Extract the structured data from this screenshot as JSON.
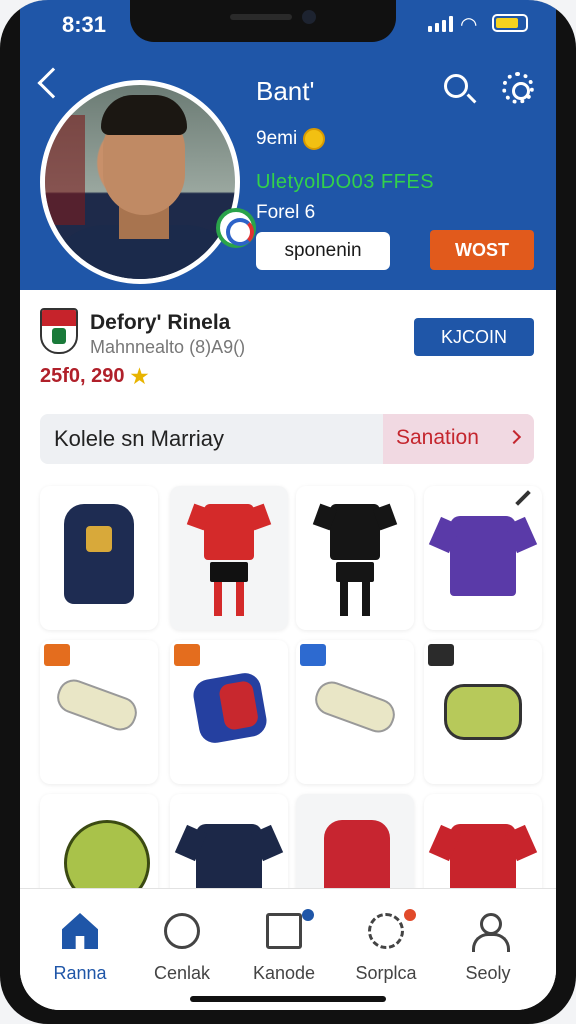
{
  "status_bar": {
    "time": "8:31"
  },
  "header": {
    "title": "Bant'",
    "line1": "9emi",
    "line2": "UletyolDO03 FFES",
    "line3": "Forel 6",
    "button_left": "sponenin",
    "button_right": "WOST"
  },
  "club": {
    "name": "Defory' Rinela",
    "subtitle": "Mahnnealto (8)A9()",
    "amount": "25f0, 290",
    "action_label": "KJCOIN"
  },
  "filter": {
    "label": "Kolele sn Marriay",
    "tab": "Sanation"
  },
  "colors": {
    "primary": "#1f56a8",
    "accent_orange": "#e15a1c",
    "price_red": "#b0202a",
    "verified_green": "#32d24a"
  },
  "products": [
    {
      "icon": "backpack-icon"
    },
    {
      "icon": "red-kit-icon"
    },
    {
      "icon": "black-kit-icon"
    },
    {
      "icon": "purple-jersey-icon"
    },
    {
      "icon": "yoga-mat-icon"
    },
    {
      "icon": "shin-pad-icon"
    },
    {
      "icon": "roll-icon"
    },
    {
      "icon": "bottle-icon"
    },
    {
      "icon": "ball-icon"
    },
    {
      "icon": "navy-jersey-icon"
    },
    {
      "icon": "red-backpack-icon"
    },
    {
      "icon": "red-jersey-icon"
    }
  ],
  "nav": [
    {
      "label": "Ranna",
      "icon": "home-icon",
      "active": true
    },
    {
      "label": "Cenlak",
      "icon": "chat-icon"
    },
    {
      "label": "Kanode",
      "icon": "document-icon"
    },
    {
      "label": "Sorplca",
      "icon": "exchange-icon"
    },
    {
      "label": "Seoly",
      "icon": "user-icon"
    }
  ]
}
